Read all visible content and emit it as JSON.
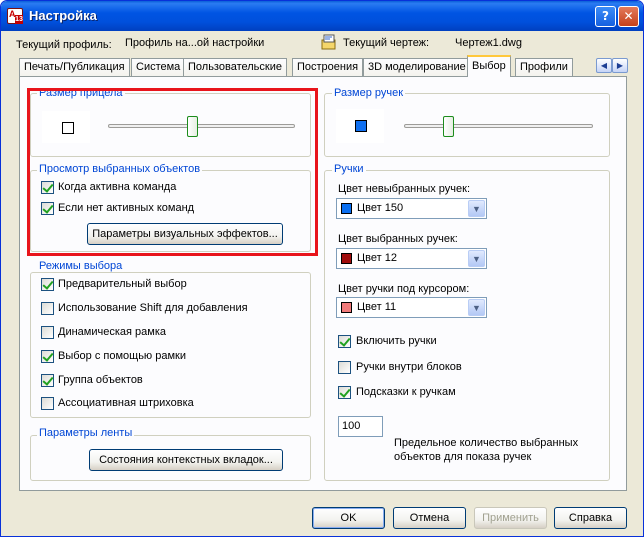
{
  "window": {
    "title": "Настройка",
    "help_glyph": "?",
    "close_glyph": "✕"
  },
  "header": {
    "profile_label": "Текущий профиль:",
    "profile_value": "Профиль на...ой настройки",
    "drawing_label": "Текущий чертеж:",
    "drawing_value": "Чертеж1.dwg"
  },
  "tabs": [
    {
      "label": "Печать/Публикация"
    },
    {
      "label": "Система"
    },
    {
      "label": "Пользовательские"
    },
    {
      "label": "Построения"
    },
    {
      "label": "3D моделирование"
    },
    {
      "label": "Выбор"
    },
    {
      "label": "Профили"
    }
  ],
  "active_tab": "Выбор",
  "left": {
    "pickbox_title": "Размер прицела",
    "pickbox_slider_fraction": 0.45,
    "preview_title": "Просмотр выбранных объектов",
    "preview_checks": [
      {
        "label": "Когда активна команда",
        "checked": true
      },
      {
        "label": "Если нет активных команд",
        "checked": true
      }
    ],
    "visual_effects_button": "Параметры визуальных эффектов...",
    "modes_title": "Режимы выбора",
    "modes_checks": [
      {
        "label": "Предварительный выбор",
        "checked": true
      },
      {
        "label": "Использование Shift для добавления",
        "checked": false
      },
      {
        "label": "Динамическая рамка",
        "checked": false
      },
      {
        "label": "Выбор с помощью рамки",
        "checked": true
      },
      {
        "label": "Группа объектов",
        "checked": true
      },
      {
        "label": "Ассоциативная штриховка",
        "checked": false
      }
    ],
    "ribbon_title": "Параметры ленты",
    "ribbon_button": "Состояния контекстных вкладок..."
  },
  "right": {
    "grip_size_title": "Размер ручек",
    "grip_slider_fraction": 0.22,
    "grips_title": "Ручки",
    "unselected_label": "Цвет невыбранных ручек:",
    "unselected_value": "Цвет 150",
    "selected_label": "Цвет выбранных ручек:",
    "selected_value": "Цвет 12",
    "hover_label": "Цвет ручки под курсором:",
    "hover_value": "Цвет 11",
    "grip_checks": [
      {
        "label": "Включить ручки",
        "checked": true
      },
      {
        "label": "Ручки внутри блоков",
        "checked": false
      },
      {
        "label": "Подсказки к ручкам",
        "checked": true
      }
    ],
    "limit_value": "100",
    "limit_label_1": "Предельное количество выбранных",
    "limit_label_2": "объектов для показа ручек"
  },
  "footer": {
    "ok": "OK",
    "cancel": "Отмена",
    "apply": "Применить",
    "help": "Справка"
  },
  "colors": {
    "highlight_border": "#e8141b",
    "color150": "#0a6ff0",
    "color12": "#a00d0d",
    "color11": "#f07a7a",
    "grip_preview": "#1070f0"
  },
  "icons": [
    "app-icon",
    "drawing-icon",
    "chevron-left-icon",
    "chevron-right-icon",
    "dropdown-arrow-icon"
  ]
}
